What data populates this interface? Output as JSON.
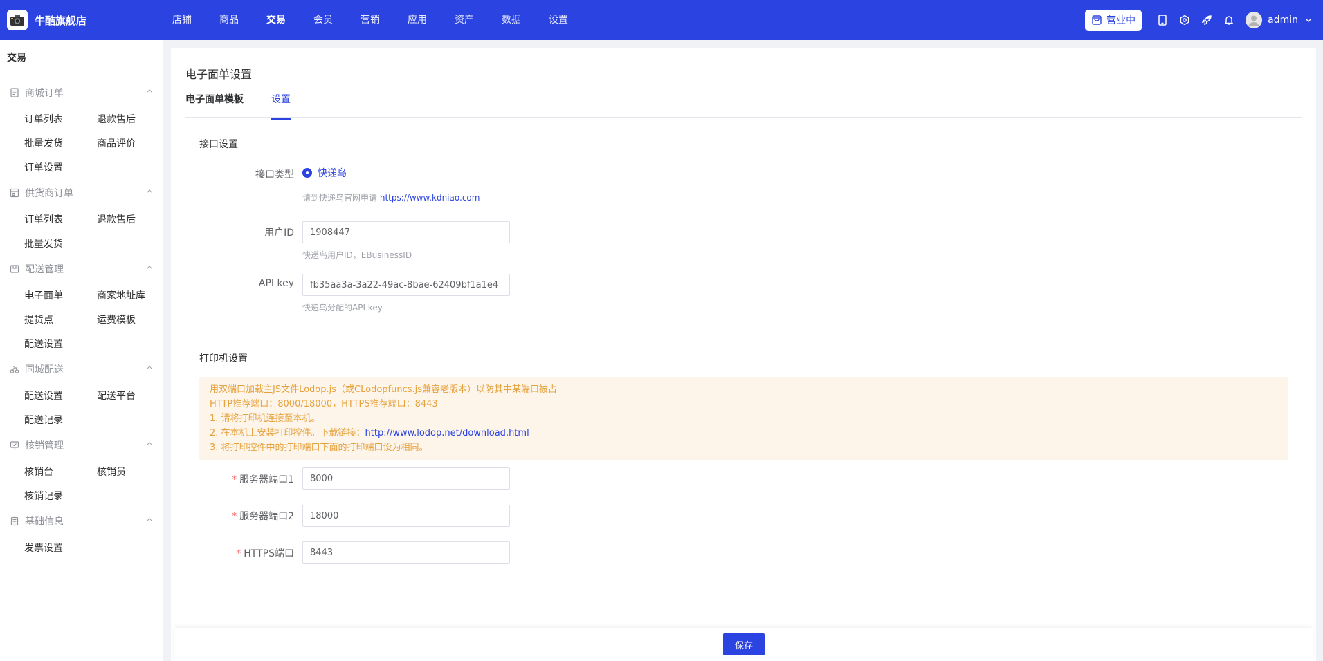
{
  "header": {
    "brand_name": "牛酷旗舰店",
    "nav": [
      "店铺",
      "商品",
      "交易",
      "会员",
      "营销",
      "应用",
      "资产",
      "数据",
      "设置"
    ],
    "active_nav": "交易",
    "status_badge": "营业中",
    "user_name": "admin"
  },
  "sidebar": {
    "title": "交易",
    "groups": [
      {
        "name": "商城订单",
        "icon": "order-icon",
        "items": [
          "订单列表",
          "退款售后",
          "批量发货",
          "商品评价",
          "订单设置"
        ]
      },
      {
        "name": "供货商订单",
        "icon": "supplier-icon",
        "items": [
          "订单列表",
          "退款售后",
          "批量发货"
        ]
      },
      {
        "name": "配送管理",
        "icon": "delivery-icon",
        "items": [
          "电子面单",
          "商家地址库",
          "提货点",
          "运费模板",
          "配送设置"
        ]
      },
      {
        "name": "同城配送",
        "icon": "bike-icon",
        "items": [
          "配送设置",
          "配送平台",
          "配送记录"
        ]
      },
      {
        "name": "核销管理",
        "icon": "verify-icon",
        "items": [
          "核销台",
          "核销员",
          "核销记录"
        ]
      },
      {
        "name": "基础信息",
        "icon": "info-icon",
        "items": [
          "发票设置"
        ]
      }
    ]
  },
  "main": {
    "page_title": "电子面单设置",
    "tabs": [
      "电子面单模板",
      "设置"
    ],
    "active_tab": "设置",
    "interface_section": "接口设置",
    "interface_type_label": "接口类型",
    "interface_type_value": "快递鸟",
    "interface_help": "请到快递鸟官网申请",
    "interface_help_link": "https://www.kdniao.com",
    "user_id_label": "用户ID",
    "user_id_value": "1908447",
    "user_id_help": "快递鸟用户ID，EBusinessID",
    "api_key_label": "API key",
    "api_key_value": "fb35aa3a-3a22-49ac-8bae-62409bf1a1e4",
    "api_key_help": "快递鸟分配的API key",
    "printer_section": "打印机设置",
    "notice_lines": [
      "用双端口加载主JS文件Lodop.js（或CLodopfuncs.js兼容老版本）以防其中某端口被占",
      "HTTP推荐端口：8000/18000，HTTPS推荐端口：8443",
      "1. 请将打印机连接至本机。"
    ],
    "notice_download_prefix": "2. 在本机上安装打印控件。下载链接：",
    "notice_download_link": "http://www.lodop.net/download.html",
    "notice_last_line": "3. 将打印控件中的打印端口下面的打印端口设为相同。",
    "port1_label": "服务器端口1",
    "port1_value": "8000",
    "port2_label": "服务器端口2",
    "port2_value": "18000",
    "https_label": "HTTPS端口",
    "https_value": "8443",
    "required_mark": "*"
  },
  "footer": {
    "save_label": "保存"
  },
  "colors": {
    "primary": "#2b43e0",
    "warning_text": "#e6a23c",
    "warning_bg": "#fdf4ea",
    "required": "#f56c6c"
  }
}
